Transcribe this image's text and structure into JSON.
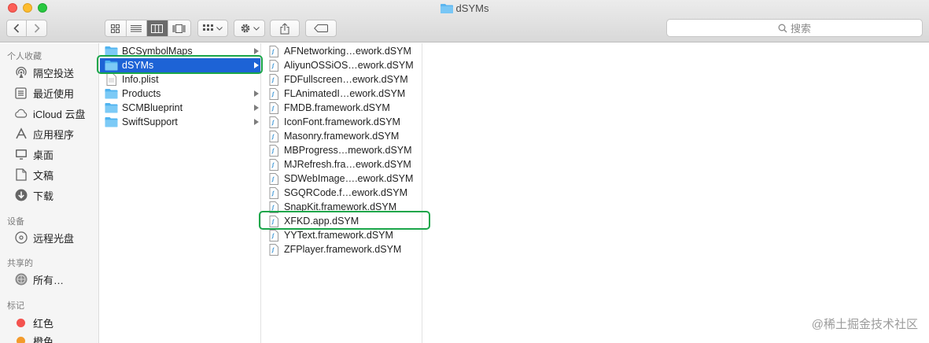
{
  "window": {
    "title": "dSYMs"
  },
  "toolbar": {
    "search_placeholder": "搜索"
  },
  "sidebar": {
    "favorites_header": "个人收藏",
    "favorites": [
      {
        "label": "隔空投送",
        "icon": "airdrop-icon"
      },
      {
        "label": "最近使用",
        "icon": "recents-icon"
      },
      {
        "label": "iCloud 云盘",
        "icon": "cloud-icon"
      },
      {
        "label": "应用程序",
        "icon": "applications-icon"
      },
      {
        "label": "桌面",
        "icon": "desktop-icon"
      },
      {
        "label": "文稿",
        "icon": "documents-icon"
      },
      {
        "label": "下载",
        "icon": "downloads-icon"
      }
    ],
    "devices_header": "设备",
    "devices": [
      {
        "label": "远程光盘",
        "icon": "disc-icon"
      }
    ],
    "shared_header": "共享的",
    "shared": [
      {
        "label": "所有…",
        "icon": "network-icon"
      }
    ],
    "tags_header": "标记",
    "tags": [
      {
        "label": "红色",
        "color": "#f4534f"
      },
      {
        "label": "橙色",
        "color": "#f39b2c"
      }
    ]
  },
  "column1": {
    "items": [
      {
        "label": "BCSymbolMaps",
        "type": "folder",
        "has_children": true
      },
      {
        "label": "dSYMs",
        "type": "folder",
        "has_children": true,
        "selected": true
      },
      {
        "label": "Info.plist",
        "type": "file",
        "has_children": false
      },
      {
        "label": "Products",
        "type": "folder",
        "has_children": true
      },
      {
        "label": "SCMBlueprint",
        "type": "folder",
        "has_children": true
      },
      {
        "label": "SwiftSupport",
        "type": "folder",
        "has_children": true
      }
    ]
  },
  "column2": {
    "items": [
      {
        "label": "AFNetworking…ework.dSYM"
      },
      {
        "label": "AliyunOSSiOS…ework.dSYM"
      },
      {
        "label": "FDFullscreen…ework.dSYM"
      },
      {
        "label": "FLAnimatedI…ework.dSYM"
      },
      {
        "label": "FMDB.framework.dSYM"
      },
      {
        "label": "IconFont.framework.dSYM"
      },
      {
        "label": "Masonry.framework.dSYM"
      },
      {
        "label": "MBProgress…mework.dSYM"
      },
      {
        "label": "MJRefresh.fra…ework.dSYM"
      },
      {
        "label": "SDWebImage….ework.dSYM"
      },
      {
        "label": "SGQRCode.f…ework.dSYM"
      },
      {
        "label": "SnapKit.framework.dSYM"
      },
      {
        "label": "XFKD.app.dSYM",
        "highlighted": true
      },
      {
        "label": "YYText.framework.dSYM"
      },
      {
        "label": "ZFPlayer.framework.dSYM"
      }
    ]
  },
  "colors": {
    "selection": "#1d63d6",
    "highlight_box": "#1aa64a",
    "folder": "#4fb3f0"
  },
  "watermark": "@稀土掘金技术社区"
}
